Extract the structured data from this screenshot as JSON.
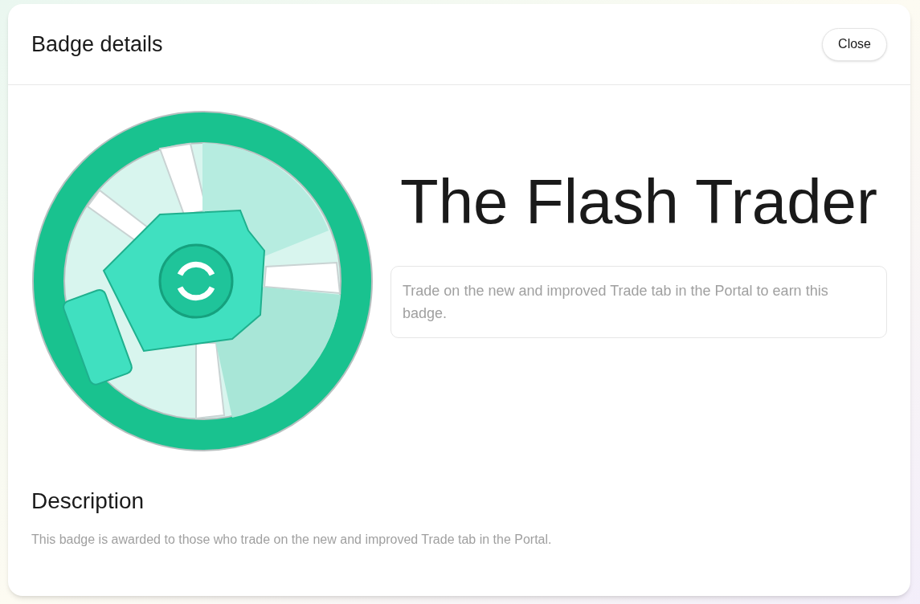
{
  "header": {
    "title": "Badge details",
    "close_button": "Close"
  },
  "badge": {
    "name": "The Flash Trader",
    "summary": "Trade on the new and improved Trade tab in the Portal to earn this badge."
  },
  "description": {
    "heading": "Description",
    "text": "This badge is awarded to those who trade on the new and improved Trade tab in the Portal."
  }
}
